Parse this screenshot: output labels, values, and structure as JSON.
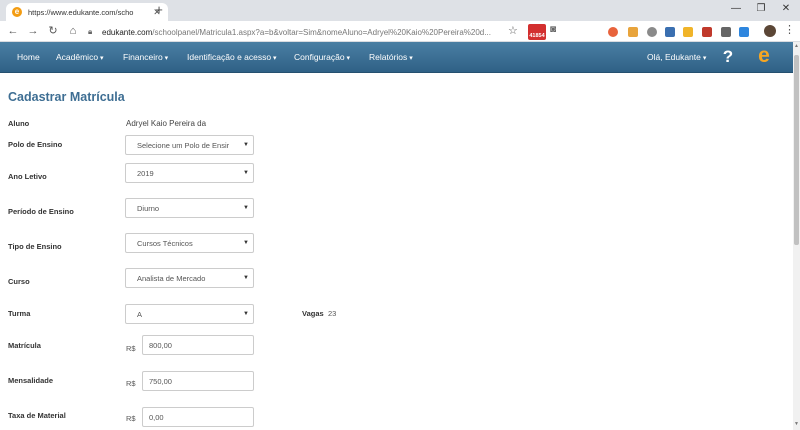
{
  "browser": {
    "tab_title": "https://www.edukante.com/scho",
    "tab_close": "✕",
    "new_tab": "+",
    "url_host": "edukante.com",
    "url_rest": "/schoolpanel/Matricula1.aspx?a=b&voltar=Sim&nomeAluno=Adryel%20Kaio%20Pereira%20d...",
    "ext_badge": "41854",
    "window_minimize": "—",
    "window_restore": "❐",
    "window_close": "✕"
  },
  "nav": {
    "home": "Home",
    "academico": "Acadêmico",
    "financeiro": "Financeiro",
    "identificacao": "Identificação e acesso",
    "configuracao": "Configuração",
    "relatorios": "Relatórios",
    "user": "Olá, Edukante",
    "help": "?",
    "logo": "e"
  },
  "page": {
    "title": "Cadastrar Matrícula"
  },
  "form": {
    "aluno_label": "Aluno",
    "aluno_value": "Adryel Kaio Pereira da",
    "polo_label": "Polo de Ensino",
    "polo_value": "Selecione um Polo de Ensir",
    "ano_label": "Ano Letivo",
    "ano_value": "2019",
    "periodo_label": "Período de Ensino",
    "periodo_value": "Diurno",
    "tipo_label": "Tipo de Ensino",
    "tipo_value": "Cursos Técnicos",
    "curso_label": "Curso",
    "curso_value": "Analista de Mercado",
    "turma_label": "Turma",
    "turma_value": "A",
    "vagas_label": "Vagas",
    "vagas_value": "23",
    "currency": "R$",
    "matricula_label": "Matrícula",
    "matricula_value": "800,00",
    "mensalidade_label": "Mensalidade",
    "mensalidade_value": "750,00",
    "taxa_label": "Taxa de Material",
    "taxa_value": "0,00"
  },
  "colors": {
    "navbar": "#2f6186",
    "title": "#3e6e93",
    "brand": "#f5a623"
  }
}
